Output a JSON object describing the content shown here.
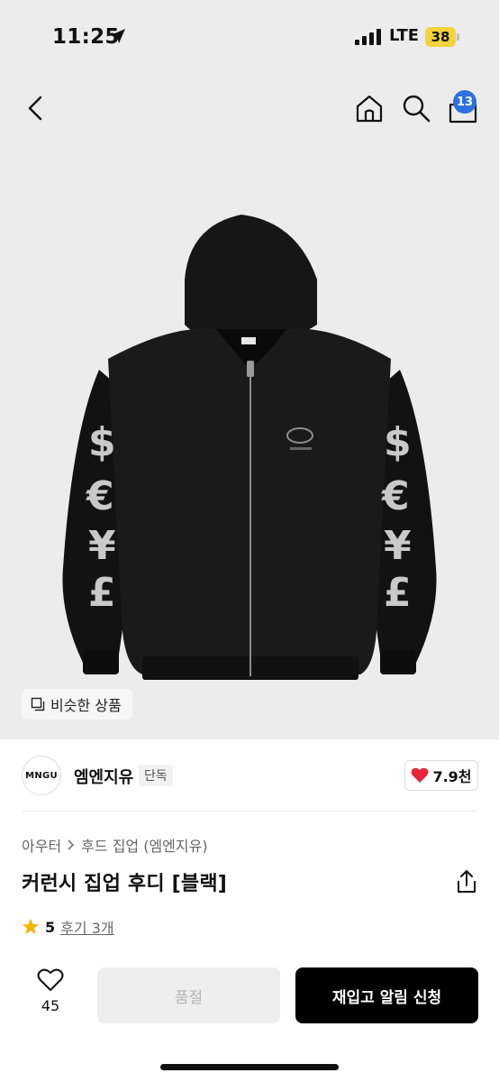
{
  "status": {
    "time": "11:25",
    "network": "LTE",
    "battery": "38"
  },
  "nav": {
    "cart_count": "13"
  },
  "image": {
    "similar_label": "비슷한 상품"
  },
  "brand": {
    "logo_text": "MNGU",
    "name": "엠엔지유",
    "tag": "단독",
    "likes": "7.9천"
  },
  "breadcrumb": {
    "category": "아우터",
    "subcategory": "후드 집업 (엠엔지유)"
  },
  "product": {
    "title": "커런시 집업 후디 [블랙]",
    "rating": "5",
    "reviews": "후기 3개"
  },
  "actions": {
    "wish_count": "45",
    "soldout_label": "품절",
    "restock_label": "재입고 알림 신청"
  },
  "colors": {
    "accent": "#2f6fe0",
    "like_heart": "#e8253a",
    "star": "#f5b400",
    "battery": "#f4d23c"
  }
}
